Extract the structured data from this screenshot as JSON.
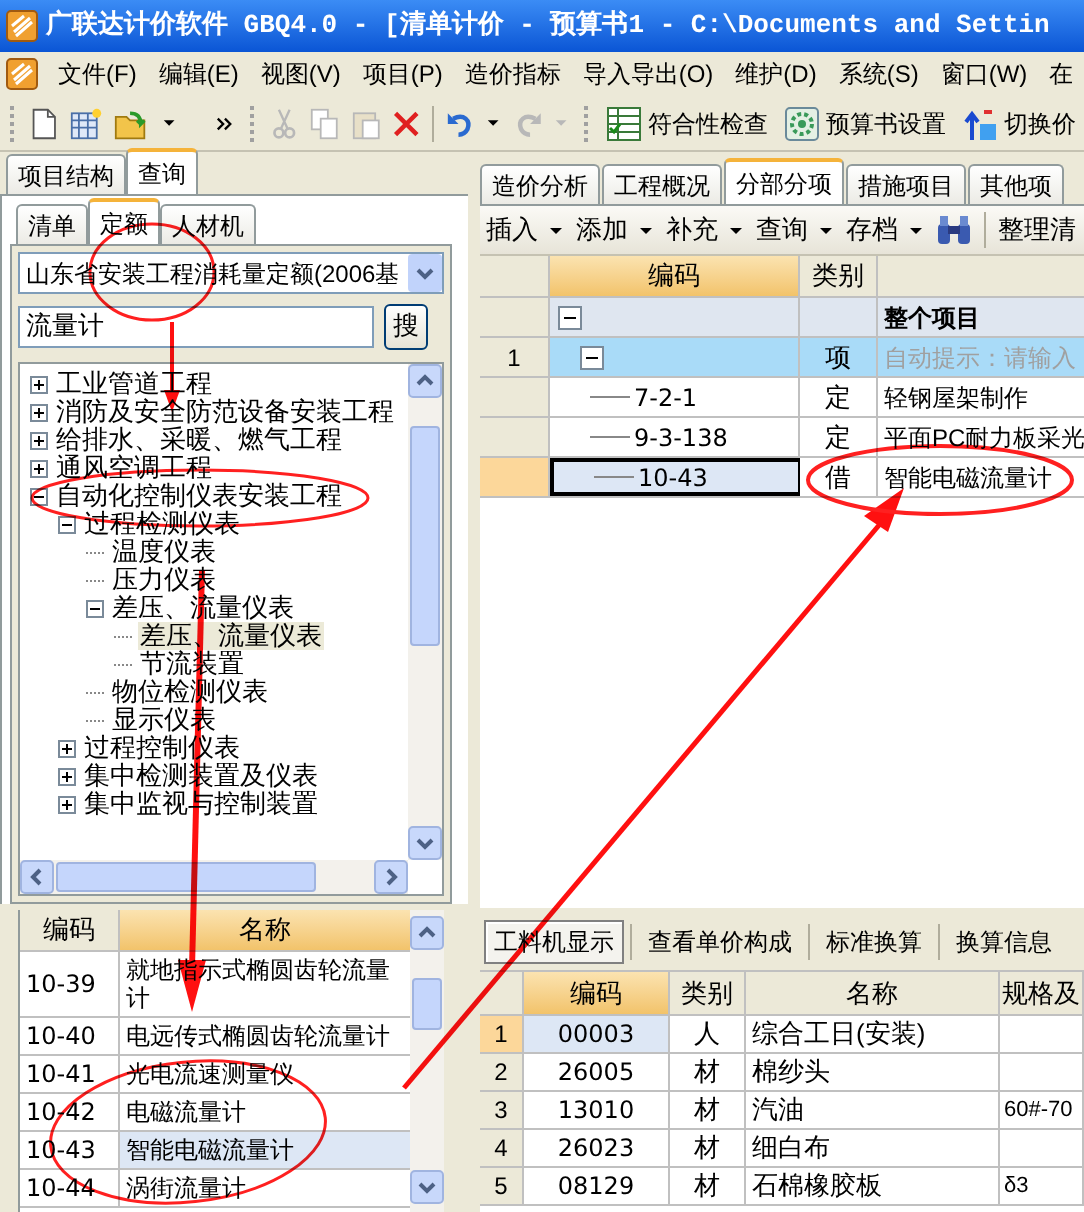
{
  "window": {
    "title": "广联达计价软件 GBQ4.0 - [清单计价 - 预算书1 - C:\\Documents and Settin"
  },
  "menu": [
    "文件(F)",
    "编辑(E)",
    "视图(V)",
    "项目(P)",
    "造价指标",
    "导入导出(O)",
    "维护(D)",
    "系统(S)",
    "窗口(W)",
    "在"
  ],
  "toolbar": {
    "edit_buttons": [
      {
        "disabled": true
      },
      {
        "disabled": true
      },
      {
        "disabled": true
      },
      {
        "disabled": false
      },
      {
        "disabled": false
      },
      {
        "disabled": true
      }
    ],
    "labeled_buttons": [
      {
        "label": "符合性检查"
      },
      {
        "label": "预算书设置"
      },
      {
        "label": "切换价"
      }
    ]
  },
  "left_panel": {
    "tabs": [
      {
        "label": "项目结构",
        "selected": false
      },
      {
        "label": "查询",
        "selected": true
      }
    ],
    "subtabs": [
      {
        "label": "清单",
        "selected": false
      },
      {
        "label": "定额",
        "selected": true
      },
      {
        "label": "人材机",
        "selected": false
      }
    ],
    "library": {
      "value": "山东省安装工程消耗量定额(2006基"
    },
    "search": {
      "value": "流量计",
      "button": "搜"
    },
    "tree": [
      {
        "label": "工业管道工程",
        "expanded": false,
        "selected": false
      },
      {
        "label": "消防及安全防范设备安装工程",
        "expanded": false,
        "selected": false
      },
      {
        "label": "给排水、采暖、燃气工程",
        "expanded": false,
        "selected": false
      },
      {
        "label": "通风空调工程",
        "expanded": false,
        "selected": false
      },
      {
        "label": "自动化控制仪表安装工程",
        "expanded": true,
        "selected": false,
        "children": [
          {
            "label": "过程检测仪表",
            "expanded": true,
            "selected": false,
            "children": [
              {
                "label": "温度仪表",
                "selected": false
              },
              {
                "label": "压力仪表",
                "selected": false
              },
              {
                "label": "差压、流量仪表",
                "expanded": true,
                "selected": false,
                "children": [
                  {
                    "label": "差压、流量仪表",
                    "selected": true
                  },
                  {
                    "label": "节流装置",
                    "selected": false
                  }
                ]
              },
              {
                "label": "物位检测仪表",
                "selected": false
              },
              {
                "label": "显示仪表",
                "selected": false
              }
            ]
          },
          {
            "label": "过程控制仪表",
            "expanded": false,
            "selected": false
          },
          {
            "label": "集中检测装置及仪表",
            "expanded": false,
            "selected": false
          },
          {
            "label": "集中监视与控制装置",
            "expanded": false,
            "selected": false
          }
        ]
      }
    ],
    "quota_table": {
      "columns": [
        "编码",
        "名称"
      ],
      "rows": [
        {
          "code": "10-39",
          "name": "就地指示式椭圆齿轮流量计",
          "selected": false
        },
        {
          "code": "10-40",
          "name": "电远传式椭圆齿轮流量计",
          "selected": false
        },
        {
          "code": "10-41",
          "name": "光电流速测量仪",
          "selected": false
        },
        {
          "code": "10-42",
          "name": "电磁流量计",
          "selected": false
        },
        {
          "code": "10-43",
          "name": "智能电磁流量计",
          "selected": true
        },
        {
          "code": "10-44",
          "name": "涡街流量计",
          "selected": false
        }
      ]
    }
  },
  "right_panel": {
    "tabs": [
      {
        "label": "造价分析",
        "selected": false
      },
      {
        "label": "工程概况",
        "selected": false
      },
      {
        "label": "分部分项",
        "selected": true
      },
      {
        "label": "措施项目",
        "selected": false
      },
      {
        "label": "其他项",
        "selected": false
      }
    ],
    "toolbar": [
      {
        "label": "插入"
      },
      {
        "label": "添加"
      },
      {
        "label": "补充"
      },
      {
        "label": "查询"
      },
      {
        "label": "存档"
      }
    ],
    "tail_button": "整理清",
    "grid": {
      "columns": [
        "编码",
        "类别"
      ],
      "rows": [
        {
          "kind": "project",
          "name": "整个项目",
          "selected": false,
          "current": false
        },
        {
          "kind": "section",
          "number": "1",
          "type": "项",
          "placeholder": "自动提示：请输入",
          "selected": true,
          "current": false
        },
        {
          "kind": "item",
          "code": "7-2-1",
          "type": "定",
          "name": "轻钢屋架制作",
          "selected": false,
          "current": false
        },
        {
          "kind": "item",
          "code": "9-3-138",
          "type": "定",
          "name": "平面PC耐力板采光",
          "selected": false,
          "current": false
        },
        {
          "kind": "item",
          "code": "10-43",
          "type": "借",
          "name": "智能电磁流量计",
          "selected": false,
          "current": true
        }
      ]
    },
    "detail_tabs": [
      {
        "label": "工料机显示",
        "selected": true
      },
      {
        "label": "查看单价构成",
        "selected": false
      },
      {
        "label": "标准换算",
        "selected": false
      },
      {
        "label": "换算信息",
        "selected": false
      }
    ],
    "resource_table": {
      "columns": [
        "编码",
        "类别",
        "名称",
        "规格及"
      ],
      "rows": [
        {
          "number": "1",
          "code": "00003",
          "type": "人",
          "name": "综合工日(安装)",
          "selected": true
        },
        {
          "number": "2",
          "code": "26005",
          "type": "材",
          "name": "棉纱头",
          "selected": false
        },
        {
          "number": "3",
          "code": "13010",
          "type": "材",
          "name": "汽油",
          "spec": "60#-70",
          "selected": false
        },
        {
          "number": "4",
          "code": "26023",
          "type": "材",
          "name": "细白布",
          "selected": false
        },
        {
          "number": "5",
          "code": "08129",
          "type": "材",
          "name": "石棉橡胶板",
          "spec": "δ3",
          "selected": false
        }
      ]
    }
  }
}
